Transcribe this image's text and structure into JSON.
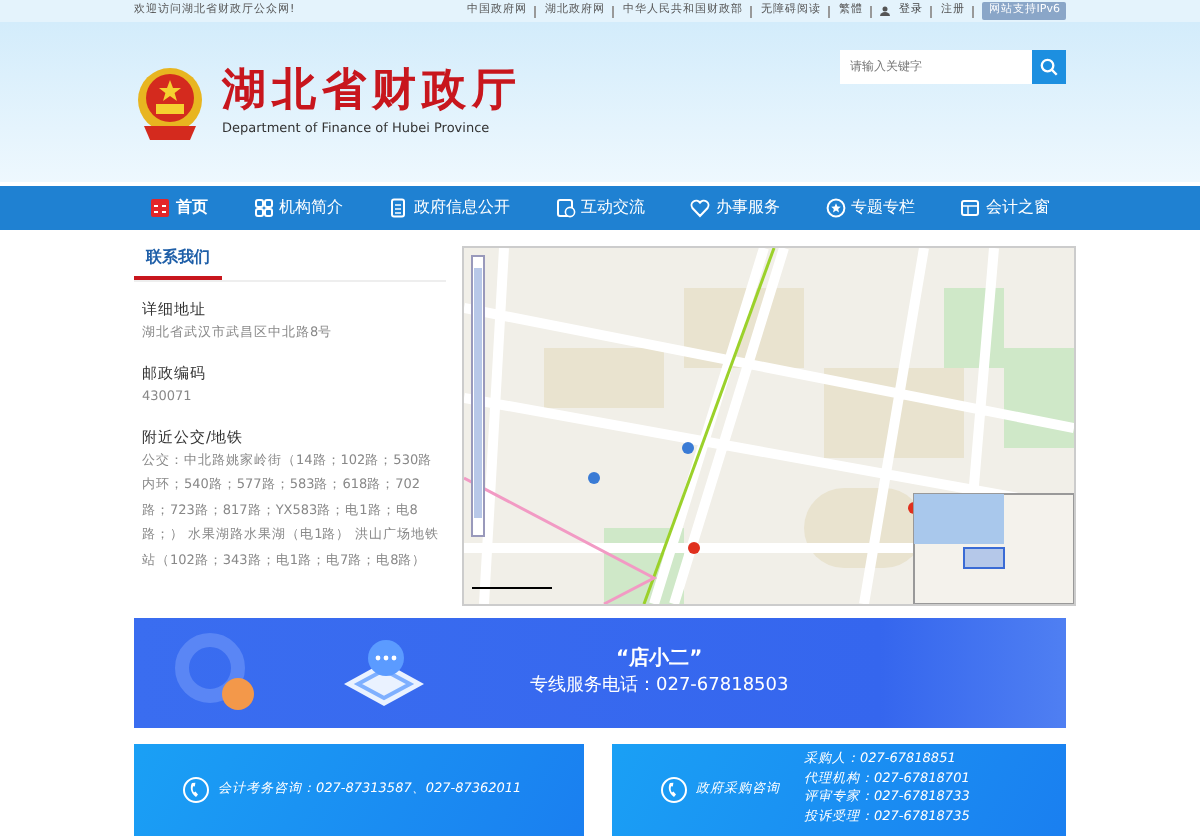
{
  "top_bar": {
    "welcome": "欢迎访问湖北省财政厅公众网!",
    "links": [
      "中国政府网",
      "湖北政府网",
      "中华人民共和国财政部",
      "无障碍阅读",
      "繁體"
    ],
    "login": "登录",
    "register": "注册",
    "ipv6_badge": "网站支持IPv6"
  },
  "header": {
    "title": "湖北省财政厅",
    "subtitle": "Department of Finance of Hubei Province",
    "search": {
      "placeholder": "请输入关键字"
    }
  },
  "nav": [
    {
      "label": "首页",
      "selected": true
    },
    {
      "label": "机构简介",
      "selected": false
    },
    {
      "label": "政府信息公开",
      "selected": false
    },
    {
      "label": "互动交流",
      "selected": false
    },
    {
      "label": "办事服务",
      "selected": false
    },
    {
      "label": "专题专栏",
      "selected": false
    },
    {
      "label": "会计之窗",
      "selected": false
    }
  ],
  "contact": {
    "heading": "联系我们",
    "sections": [
      {
        "title": "详细地址",
        "text": "湖北省武汉市武昌区中北路8号"
      },
      {
        "title": "邮政编码",
        "text": "430071"
      },
      {
        "title": "附近公交/地铁",
        "text": "公交：中北路姚家岭街（14路；102路；530路内环；540路；577路；583路；618路；702路；723路；817路；YX583路；电1路；电8路；） 水果湖路水果湖（电1路） 洪山广场地铁站（102路；343路；电1路；电7路；电8路）"
      }
    ]
  },
  "banner": {
    "title": "“店小二”",
    "phone": "专线服务电话：027-67818503"
  },
  "cards": [
    {
      "lines": [
        "会计考务咨询：027-87313587、027-87362011"
      ]
    },
    {
      "title": "政府采购咨询",
      "lines": [
        "采购人：027-67818851",
        "代理机构：027-67818701",
        "评审专家：027-67818733",
        "投诉受理：027-67818735"
      ]
    }
  ]
}
